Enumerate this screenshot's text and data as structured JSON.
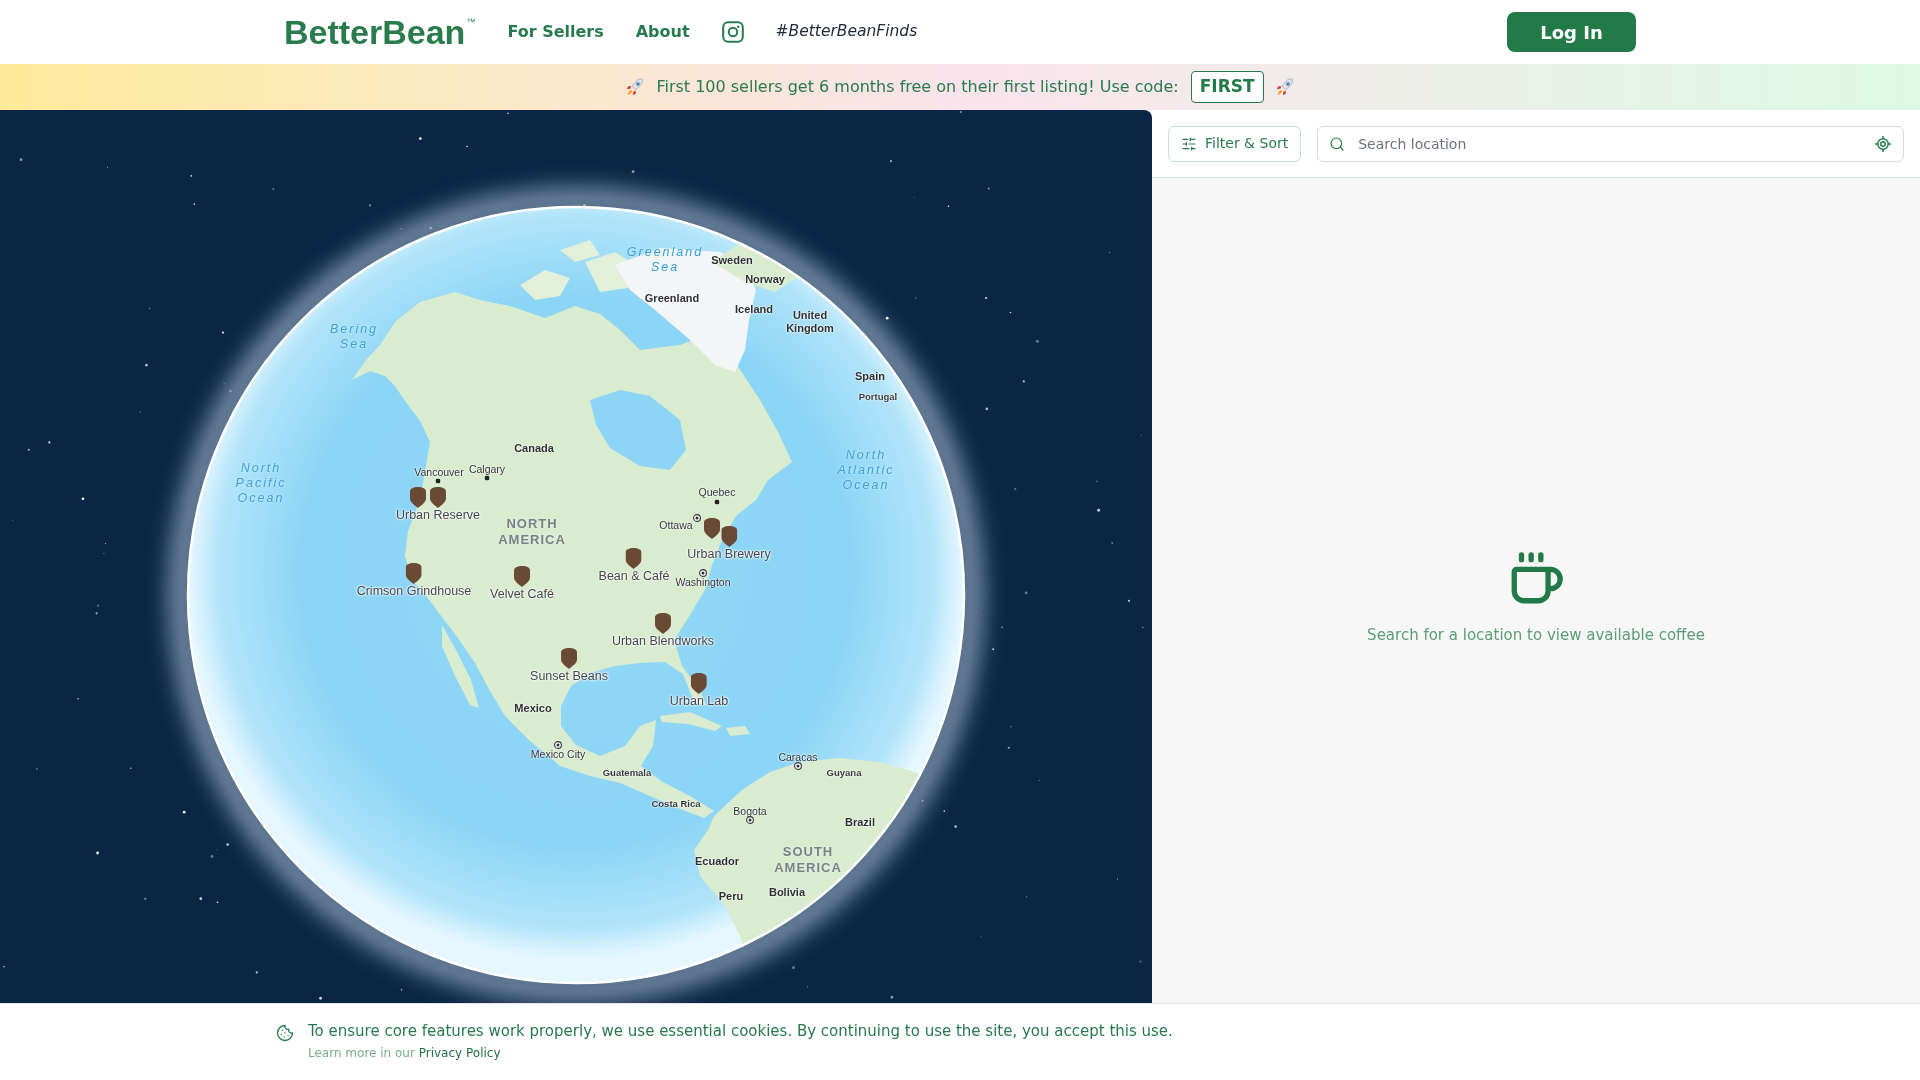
{
  "header": {
    "logo": {
      "name": "BetterBean",
      "trademark": "™"
    },
    "nav": [
      {
        "kind": "link",
        "label": "For Sellers"
      },
      {
        "kind": "link",
        "label": "About"
      },
      {
        "kind": "icon"
      },
      {
        "kind": "hashtag",
        "label": "#BetterBeanFinds"
      }
    ],
    "login_button": "Log In"
  },
  "banner": {
    "text": "First 100 sellers get 6 months free on their first listing! Use code:",
    "code": "FIRST"
  },
  "map": {
    "place_labels": [
      {
        "kind": "sea",
        "text": "Greenland Sea"
      },
      {
        "kind": "country",
        "text": "Sweden"
      },
      {
        "kind": "country",
        "text": "Norway"
      },
      {
        "kind": "country",
        "text": "Greenland"
      },
      {
        "kind": "country",
        "text": "Iceland"
      },
      {
        "kind": "country",
        "text": "United Kingdom"
      },
      {
        "kind": "sea",
        "text": "Bering Sea"
      },
      {
        "kind": "country",
        "text": "Spain"
      },
      {
        "kind": "country_small",
        "text": "Portugal"
      },
      {
        "kind": "country",
        "text": "Canada"
      },
      {
        "kind": "sea",
        "text": "North Pacific Ocean"
      },
      {
        "kind": "city",
        "text": "Vancouver"
      },
      {
        "kind": "city",
        "text": "Calgary"
      },
      {
        "kind": "sea",
        "text": "North Atlantic Ocean"
      },
      {
        "kind": "city",
        "text": "Quebec"
      },
      {
        "kind": "continent",
        "text": "NORTH AMERICA"
      },
      {
        "kind": "capital",
        "text": "Ottawa"
      },
      {
        "kind": "capital",
        "text": "Washington"
      },
      {
        "kind": "country",
        "text": "Mexico"
      },
      {
        "kind": "capital",
        "text": "Mexico City"
      },
      {
        "kind": "capital",
        "text": "Caracas"
      },
      {
        "kind": "country_small",
        "text": "Guatemala"
      },
      {
        "kind": "country_small",
        "text": "Guyana"
      },
      {
        "kind": "country_small",
        "text": "Costa Rica"
      },
      {
        "kind": "capital",
        "text": "Bogota"
      },
      {
        "kind": "country",
        "text": "Brazil"
      },
      {
        "kind": "country",
        "text": "Ecuador"
      },
      {
        "kind": "continent",
        "text": "SOUTH AMERICA"
      },
      {
        "kind": "country",
        "text": "Peru"
      },
      {
        "kind": "country",
        "text": "Bolivia"
      }
    ],
    "shops": [
      {
        "kind": "pin"
      },
      {
        "kind": "labeled_pin",
        "name": "Urban Reserve"
      },
      {
        "kind": "pin"
      },
      {
        "kind": "labeled_pin",
        "name": "Urban Brewery"
      },
      {
        "kind": "labeled_pin",
        "name": "Bean & Café"
      },
      {
        "kind": "labeled_pin",
        "name": "Crimson Grindhouse"
      },
      {
        "kind": "labeled_pin",
        "name": "Velvet Café"
      },
      {
        "kind": "labeled_pin",
        "name": "Urban Blendworks"
      },
      {
        "kind": "labeled_pin",
        "name": "Sunset Beans"
      },
      {
        "kind": "labeled_pin",
        "name": "Urban Lab"
      }
    ]
  },
  "panel": {
    "filter_button": "Filter & Sort",
    "search": {
      "placeholder": "Search location"
    },
    "empty_message": "Search for a location to view available coffee"
  },
  "cookie_banner": {
    "message": "To ensure core features work properly, we use essential cookies. By continuing to use the site, you accept this use.",
    "note": "Learn more in our",
    "link": "Privacy Policy"
  }
}
